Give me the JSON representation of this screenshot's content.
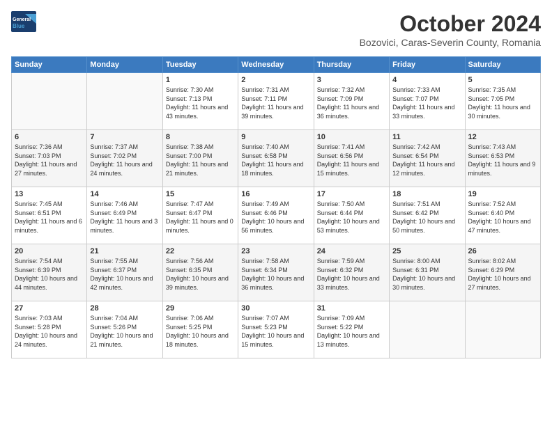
{
  "logo": {
    "line1": "General",
    "line2": "Blue"
  },
  "title": "October 2024",
  "subtitle": "Bozovici, Caras-Severin County, Romania",
  "days_header": [
    "Sunday",
    "Monday",
    "Tuesday",
    "Wednesday",
    "Thursday",
    "Friday",
    "Saturday"
  ],
  "weeks": [
    [
      {
        "day": "",
        "info": ""
      },
      {
        "day": "",
        "info": ""
      },
      {
        "day": "1",
        "info": "Sunrise: 7:30 AM\nSunset: 7:13 PM\nDaylight: 11 hours and 43 minutes."
      },
      {
        "day": "2",
        "info": "Sunrise: 7:31 AM\nSunset: 7:11 PM\nDaylight: 11 hours and 39 minutes."
      },
      {
        "day": "3",
        "info": "Sunrise: 7:32 AM\nSunset: 7:09 PM\nDaylight: 11 hours and 36 minutes."
      },
      {
        "day": "4",
        "info": "Sunrise: 7:33 AM\nSunset: 7:07 PM\nDaylight: 11 hours and 33 minutes."
      },
      {
        "day": "5",
        "info": "Sunrise: 7:35 AM\nSunset: 7:05 PM\nDaylight: 11 hours and 30 minutes."
      }
    ],
    [
      {
        "day": "6",
        "info": "Sunrise: 7:36 AM\nSunset: 7:03 PM\nDaylight: 11 hours and 27 minutes."
      },
      {
        "day": "7",
        "info": "Sunrise: 7:37 AM\nSunset: 7:02 PM\nDaylight: 11 hours and 24 minutes."
      },
      {
        "day": "8",
        "info": "Sunrise: 7:38 AM\nSunset: 7:00 PM\nDaylight: 11 hours and 21 minutes."
      },
      {
        "day": "9",
        "info": "Sunrise: 7:40 AM\nSunset: 6:58 PM\nDaylight: 11 hours and 18 minutes."
      },
      {
        "day": "10",
        "info": "Sunrise: 7:41 AM\nSunset: 6:56 PM\nDaylight: 11 hours and 15 minutes."
      },
      {
        "day": "11",
        "info": "Sunrise: 7:42 AM\nSunset: 6:54 PM\nDaylight: 11 hours and 12 minutes."
      },
      {
        "day": "12",
        "info": "Sunrise: 7:43 AM\nSunset: 6:53 PM\nDaylight: 11 hours and 9 minutes."
      }
    ],
    [
      {
        "day": "13",
        "info": "Sunrise: 7:45 AM\nSunset: 6:51 PM\nDaylight: 11 hours and 6 minutes."
      },
      {
        "day": "14",
        "info": "Sunrise: 7:46 AM\nSunset: 6:49 PM\nDaylight: 11 hours and 3 minutes."
      },
      {
        "day": "15",
        "info": "Sunrise: 7:47 AM\nSunset: 6:47 PM\nDaylight: 11 hours and 0 minutes."
      },
      {
        "day": "16",
        "info": "Sunrise: 7:49 AM\nSunset: 6:46 PM\nDaylight: 10 hours and 56 minutes."
      },
      {
        "day": "17",
        "info": "Sunrise: 7:50 AM\nSunset: 6:44 PM\nDaylight: 10 hours and 53 minutes."
      },
      {
        "day": "18",
        "info": "Sunrise: 7:51 AM\nSunset: 6:42 PM\nDaylight: 10 hours and 50 minutes."
      },
      {
        "day": "19",
        "info": "Sunrise: 7:52 AM\nSunset: 6:40 PM\nDaylight: 10 hours and 47 minutes."
      }
    ],
    [
      {
        "day": "20",
        "info": "Sunrise: 7:54 AM\nSunset: 6:39 PM\nDaylight: 10 hours and 44 minutes."
      },
      {
        "day": "21",
        "info": "Sunrise: 7:55 AM\nSunset: 6:37 PM\nDaylight: 10 hours and 42 minutes."
      },
      {
        "day": "22",
        "info": "Sunrise: 7:56 AM\nSunset: 6:35 PM\nDaylight: 10 hours and 39 minutes."
      },
      {
        "day": "23",
        "info": "Sunrise: 7:58 AM\nSunset: 6:34 PM\nDaylight: 10 hours and 36 minutes."
      },
      {
        "day": "24",
        "info": "Sunrise: 7:59 AM\nSunset: 6:32 PM\nDaylight: 10 hours and 33 minutes."
      },
      {
        "day": "25",
        "info": "Sunrise: 8:00 AM\nSunset: 6:31 PM\nDaylight: 10 hours and 30 minutes."
      },
      {
        "day": "26",
        "info": "Sunrise: 8:02 AM\nSunset: 6:29 PM\nDaylight: 10 hours and 27 minutes."
      }
    ],
    [
      {
        "day": "27",
        "info": "Sunrise: 7:03 AM\nSunset: 5:28 PM\nDaylight: 10 hours and 24 minutes."
      },
      {
        "day": "28",
        "info": "Sunrise: 7:04 AM\nSunset: 5:26 PM\nDaylight: 10 hours and 21 minutes."
      },
      {
        "day": "29",
        "info": "Sunrise: 7:06 AM\nSunset: 5:25 PM\nDaylight: 10 hours and 18 minutes."
      },
      {
        "day": "30",
        "info": "Sunrise: 7:07 AM\nSunset: 5:23 PM\nDaylight: 10 hours and 15 minutes."
      },
      {
        "day": "31",
        "info": "Sunrise: 7:09 AM\nSunset: 5:22 PM\nDaylight: 10 hours and 13 minutes."
      },
      {
        "day": "",
        "info": ""
      },
      {
        "day": "",
        "info": ""
      }
    ]
  ]
}
